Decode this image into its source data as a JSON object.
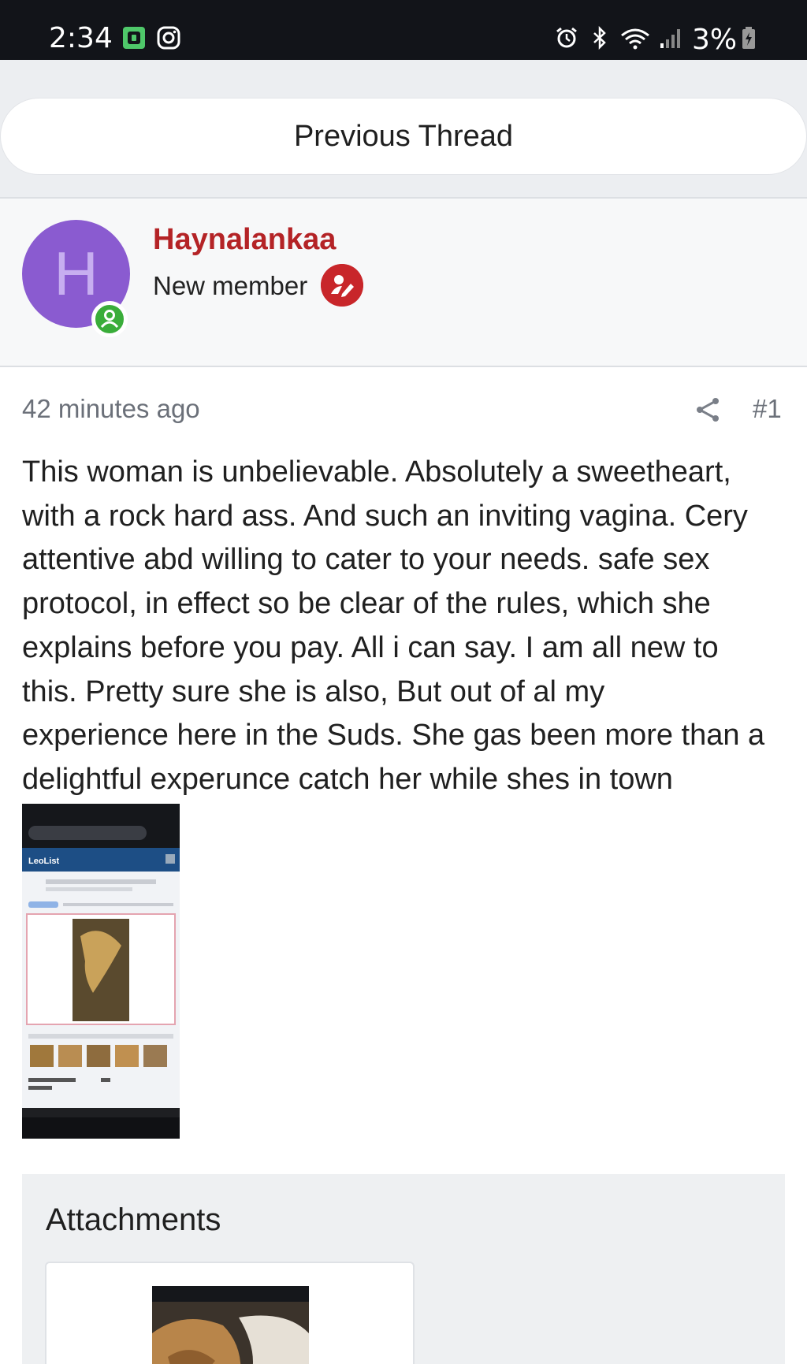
{
  "status_bar": {
    "time": "2:34",
    "battery": "3%",
    "icons": [
      "app-notification-icon",
      "instagram-icon",
      "alarm-icon",
      "bluetooth-icon",
      "wifi-icon",
      "signal-icon",
      "battery-charging-icon"
    ]
  },
  "navigation": {
    "previous_thread_label": "Previous Thread"
  },
  "author": {
    "avatar_letter": "H",
    "avatar_color": "#8a5bd0",
    "username": "Haynalankaa",
    "role": "New member",
    "username_color": "#b42326",
    "online_color": "#3aad3a"
  },
  "post": {
    "timestamp": "42 minutes ago",
    "number": "#1",
    "body_lines": [
      "This woman is unbelievable. Absolutely a sweetheart,",
      "with a rock hard ass. And such an inviting vagina. Cery",
      "attentive abd willing to cater to your needs. safe sex",
      "protocol, in effect so be clear of the rules, which she",
      "explains before you pay. All i can say. I am all new to",
      "this. Pretty sure she is also, But out of al my",
      "experience here in the Suds. She gas been more than a",
      "delightful experunce catch her while shes in town"
    ],
    "inline_image_label": "LeoList"
  },
  "attachments": {
    "title": "Attachments"
  }
}
